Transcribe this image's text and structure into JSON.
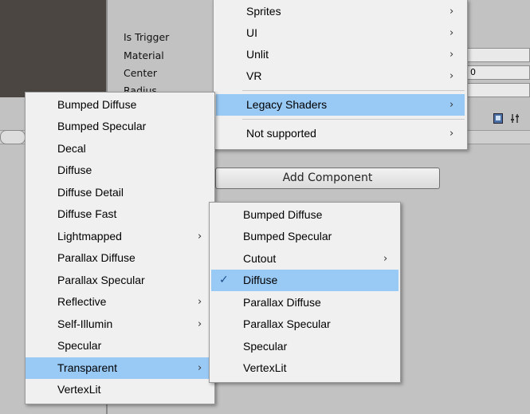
{
  "inspector": {
    "labels": [
      "Is Trigger",
      "Material",
      "Center",
      "Radius"
    ],
    "center_value": "0",
    "add_component_label": "Add Component"
  },
  "menu_top": {
    "items": [
      {
        "label": "Sprites",
        "submenu": true
      },
      {
        "label": "UI",
        "submenu": true
      },
      {
        "label": "Unlit",
        "submenu": true
      },
      {
        "label": "VR",
        "submenu": true
      },
      {
        "label": "Legacy Shaders",
        "submenu": true,
        "highlighted": true
      },
      {
        "label": "Not supported",
        "submenu": true
      }
    ]
  },
  "menu_legacy": {
    "items": [
      {
        "label": "Bumped Diffuse"
      },
      {
        "label": "Bumped Specular"
      },
      {
        "label": "Decal"
      },
      {
        "label": "Diffuse"
      },
      {
        "label": "Diffuse Detail"
      },
      {
        "label": "Diffuse Fast"
      },
      {
        "label": "Lightmapped",
        "submenu": true
      },
      {
        "label": "Parallax Diffuse"
      },
      {
        "label": "Parallax Specular"
      },
      {
        "label": "Reflective",
        "submenu": true
      },
      {
        "label": "Self-Illumin",
        "submenu": true
      },
      {
        "label": "Specular"
      },
      {
        "label": "Transparent",
        "submenu": true,
        "highlighted": true
      },
      {
        "label": "VertexLit"
      }
    ]
  },
  "menu_transparent": {
    "items": [
      {
        "label": "Bumped Diffuse"
      },
      {
        "label": "Bumped Specular"
      },
      {
        "label": "Cutout",
        "submenu": true
      },
      {
        "label": "Diffuse",
        "checked": true,
        "highlighted": true
      },
      {
        "label": "Parallax Diffuse"
      },
      {
        "label": "Parallax Specular"
      },
      {
        "label": "Specular"
      },
      {
        "label": "VertexLit"
      }
    ]
  },
  "glyphs": {
    "arrow": "›",
    "check": "✓"
  },
  "colors": {
    "highlight": "#99c9f5",
    "menu_bg": "#f0f0f0"
  }
}
